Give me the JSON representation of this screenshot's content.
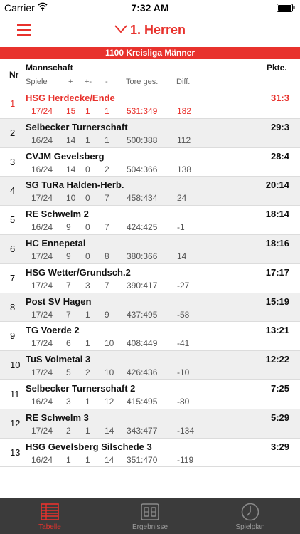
{
  "status_bar": {
    "carrier": "Carrier",
    "time": "7:32 AM"
  },
  "navbar": {
    "title": "1. Herren"
  },
  "league": "1100 Kreisliga Männer",
  "header": {
    "nr": "Nr",
    "team": "Mannschaft",
    "points": "Pkte.",
    "games": "Spiele",
    "wins": "+",
    "draws": "+-",
    "losses": "-",
    "goals": "Tore ges.",
    "diff": "Diff."
  },
  "rows": [
    {
      "nr": "1",
      "team": "HSG Herdecke/Ende",
      "games": "17/24",
      "w": "15",
      "d": "1",
      "l": "1",
      "goals": "531:349",
      "diff": "182",
      "points": "31:3"
    },
    {
      "nr": "2",
      "team": "Selbecker Turnerschaft",
      "games": "16/24",
      "w": "14",
      "d": "1",
      "l": "1",
      "goals": "500:388",
      "diff": "112",
      "points": "29:3"
    },
    {
      "nr": "3",
      "team": "CVJM Gevelsberg",
      "games": "16/24",
      "w": "14",
      "d": "0",
      "l": "2",
      "goals": "504:366",
      "diff": "138",
      "points": "28:4"
    },
    {
      "nr": "4",
      "team": "SG TuRa Halden-Herb.",
      "games": "17/24",
      "w": "10",
      "d": "0",
      "l": "7",
      "goals": "458:434",
      "diff": "24",
      "points": "20:14"
    },
    {
      "nr": "5",
      "team": "RE Schwelm 2",
      "games": "16/24",
      "w": "9",
      "d": "0",
      "l": "7",
      "goals": "424:425",
      "diff": "-1",
      "points": "18:14"
    },
    {
      "nr": "6",
      "team": "HC Ennepetal",
      "games": "17/24",
      "w": "9",
      "d": "0",
      "l": "8",
      "goals": "380:366",
      "diff": "14",
      "points": "18:16"
    },
    {
      "nr": "7",
      "team": "HSG Wetter/Grundsch.2",
      "games": "17/24",
      "w": "7",
      "d": "3",
      "l": "7",
      "goals": "390:417",
      "diff": "-27",
      "points": "17:17"
    },
    {
      "nr": "8",
      "team": "Post SV Hagen",
      "games": "17/24",
      "w": "7",
      "d": "1",
      "l": "9",
      "goals": "437:495",
      "diff": "-58",
      "points": "15:19"
    },
    {
      "nr": "9",
      "team": "TG Voerde 2",
      "games": "17/24",
      "w": "6",
      "d": "1",
      "l": "10",
      "goals": "408:449",
      "diff": "-41",
      "points": "13:21"
    },
    {
      "nr": "10",
      "team": "TuS Volmetal 3",
      "games": "17/24",
      "w": "5",
      "d": "2",
      "l": "10",
      "goals": "426:436",
      "diff": "-10",
      "points": "12:22"
    },
    {
      "nr": "11",
      "team": "Selbecker Turnerschaft 2",
      "games": "16/24",
      "w": "3",
      "d": "1",
      "l": "12",
      "goals": "415:495",
      "diff": "-80",
      "points": "7:25"
    },
    {
      "nr": "12",
      "team": "RE Schwelm 3",
      "games": "17/24",
      "w": "2",
      "d": "1",
      "l": "14",
      "goals": "343:477",
      "diff": "-134",
      "points": "5:29"
    },
    {
      "nr": "13",
      "team": "HSG Gevelsberg Silschede 3",
      "games": "16/24",
      "w": "1",
      "d": "1",
      "l": "14",
      "goals": "351:470",
      "diff": "-119",
      "points": "3:29"
    }
  ],
  "tabs": [
    {
      "label": "Tabelle",
      "icon": "table-icon",
      "active": true
    },
    {
      "label": "Ergebnisse",
      "icon": "scoreboard-icon",
      "active": false
    },
    {
      "label": "Spielplan",
      "icon": "clock-icon",
      "active": false
    }
  ],
  "colors": {
    "accent": "#e8322d",
    "tabbar": "#3b3b3b"
  }
}
